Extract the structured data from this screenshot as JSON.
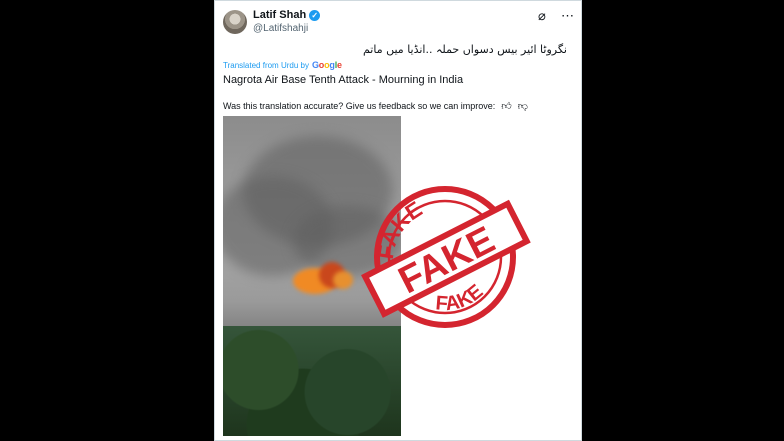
{
  "tweet": {
    "display_name": "Latif Shah",
    "handle": "@Latifshahji",
    "original_text": "نگروٹا ائیر بیس دسواں حملہ ..انڈیا میں ماتم",
    "translated_from": "Translated from Urdu by",
    "google_logo": "Google",
    "translation": "Nagrota Air Base Tenth Attack - Mourning in India",
    "feedback_prompt": "Was this translation accurate? Give us feedback so we can improve:"
  },
  "icons": {
    "verified": "verified-badge-icon",
    "grok": "grok-icon",
    "more": "more-options-icon",
    "thumbs_up": "thumbs-up-icon",
    "thumbs_down": "thumbs-down-icon"
  },
  "stamp": {
    "big_text": "FAKE",
    "top_text": "FAKE",
    "bottom_text": "FAKE",
    "color": "#d4252f"
  },
  "colors": {
    "accent": "#1d9bf0",
    "text": "#0f1419",
    "muted": "#536471",
    "background": "#000000"
  }
}
